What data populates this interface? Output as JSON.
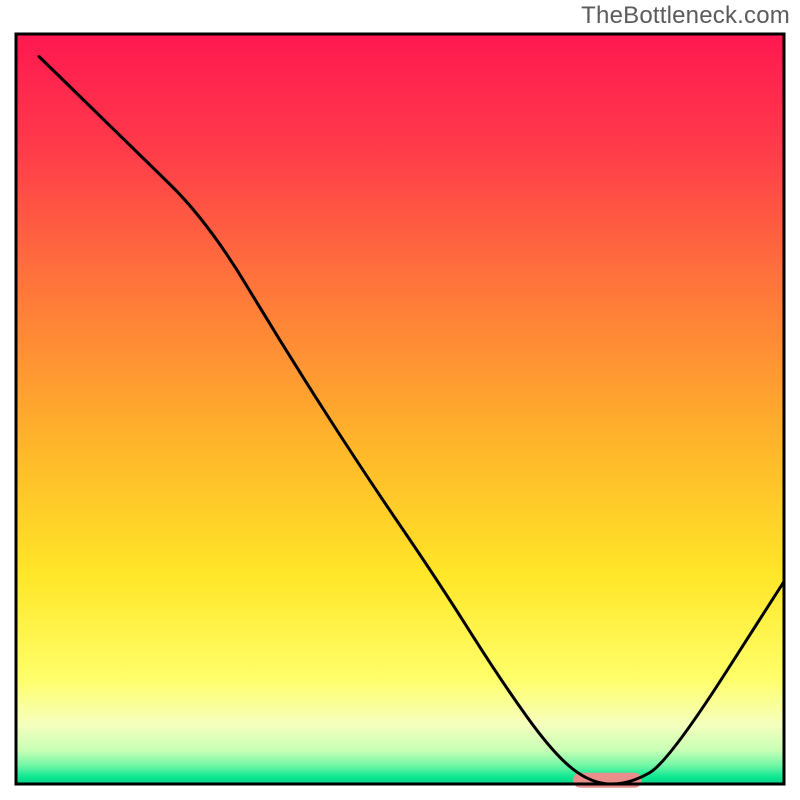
{
  "watermark": "TheBottleneck.com",
  "chart_data": {
    "type": "line",
    "title": "",
    "xlabel": "",
    "ylabel": "",
    "xlim": [
      0,
      100
    ],
    "ylim": [
      0,
      100
    ],
    "x": [
      3,
      15,
      25,
      35,
      45,
      55,
      63,
      70,
      75,
      80,
      85,
      100
    ],
    "values": [
      97,
      85,
      75,
      58,
      42,
      27,
      14,
      4,
      0,
      0,
      3,
      27
    ],
    "curve_note": "Black curve drops from top-left, reaches a minimum plateau near x≈75–80 (y≈0), touches the salmon marker, then rises toward the right edge.",
    "marker": {
      "x_center": 77,
      "y_center": 0.5,
      "width": 9,
      "height": 2,
      "color": "#e98e8a",
      "shape": "rounded-rect"
    },
    "background_gradient": {
      "stops": [
        {
          "pos": 0.0,
          "color": "#ff1850"
        },
        {
          "pos": 0.15,
          "color": "#ff3a4a"
        },
        {
          "pos": 0.35,
          "color": "#ff7a3a"
        },
        {
          "pos": 0.55,
          "color": "#ffb62a"
        },
        {
          "pos": 0.72,
          "color": "#ffe627"
        },
        {
          "pos": 0.86,
          "color": "#ffff6a"
        },
        {
          "pos": 0.92,
          "color": "#f6ffbd"
        },
        {
          "pos": 0.955,
          "color": "#c8ffb5"
        },
        {
          "pos": 0.975,
          "color": "#72f7a6"
        },
        {
          "pos": 0.99,
          "color": "#10e892"
        },
        {
          "pos": 1.0,
          "color": "#06d186"
        }
      ]
    },
    "border": {
      "color": "#000000",
      "width": 3
    }
  }
}
